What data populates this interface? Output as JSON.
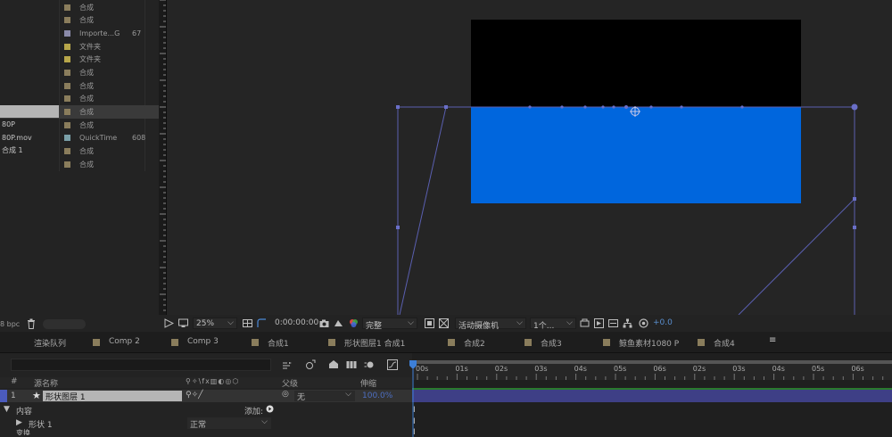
{
  "project": {
    "items": [
      {
        "name": "",
        "type": "合成",
        "size": "",
        "color": "#8a7d5c",
        "selected": false,
        "highlight": false
      },
      {
        "name": "",
        "type": "合成",
        "size": "",
        "color": "#8a7d5c",
        "selected": false,
        "highlight": false
      },
      {
        "name": "",
        "type": "Importe...G",
        "size": "67",
        "color": "#8a8aaa",
        "selected": false,
        "highlight": false
      },
      {
        "name": "",
        "type": "文件夹",
        "size": "",
        "color": "#b7a64a",
        "selected": false,
        "highlight": false
      },
      {
        "name": "",
        "type": "文件夹",
        "size": "",
        "color": "#b7a64a",
        "selected": false,
        "highlight": false
      },
      {
        "name": "",
        "type": "合成",
        "size": "",
        "color": "#8a7d5c",
        "selected": false,
        "highlight": false
      },
      {
        "name": "",
        "type": "合成",
        "size": "",
        "color": "#8a7d5c",
        "selected": false,
        "highlight": false
      },
      {
        "name": "",
        "type": "合成",
        "size": "",
        "color": "#8a7d5c",
        "selected": false,
        "highlight": false
      },
      {
        "name": "",
        "type": "合成",
        "size": "",
        "color": "#8a7d5c",
        "selected": true,
        "highlight": true
      },
      {
        "name": "80P",
        "type": "合成",
        "size": "",
        "color": "#8a7d5c",
        "selected": false,
        "highlight": false
      },
      {
        "name": "80P.mov",
        "type": "QuickTime",
        "size": "608",
        "color": "#7aa0a8",
        "selected": false,
        "highlight": false
      },
      {
        "name": "合成 1",
        "type": "合成",
        "size": "",
        "color": "#8a7d5c",
        "selected": false,
        "highlight": false
      },
      {
        "name": "",
        "type": "合成",
        "size": "",
        "color": "#8a7d5c",
        "selected": false,
        "highlight": false
      }
    ],
    "bpc_label": "8 bpc"
  },
  "viewer": {
    "zoom": "25%",
    "timecode": "0:00:00:00",
    "resolution": "完整",
    "camera": "活动摄像机",
    "views": "1个...",
    "exposure": "+0.0",
    "comp_color": "#000000",
    "shape_color": "#0066dd",
    "path_color": "#5a5fb0"
  },
  "tabs": [
    {
      "label": "渲染队列",
      "swatch": null
    },
    {
      "label": "Comp 2",
      "swatch": "#8a7d5c"
    },
    {
      "label": "Comp 3",
      "swatch": "#8a7d5c"
    },
    {
      "label": "合成1",
      "swatch": "#8a7d5c"
    },
    {
      "label": "形状图层1 合成1",
      "swatch": "#8a7d5c"
    },
    {
      "label": "合成2",
      "swatch": "#8a7d5c"
    },
    {
      "label": "合成3",
      "swatch": "#8a7d5c"
    },
    {
      "label": "鲸鱼素材1080 P",
      "swatch": "#8a7d5c"
    },
    {
      "label": "合成4",
      "swatch": "#8a7d5c"
    }
  ],
  "layers": {
    "search_placeholder": "",
    "col_hash": "#",
    "col_source": "源名称",
    "col_parent": "父级",
    "col_stretch": "伸缩",
    "layer_index": "1",
    "layer_name": "形状图层 1",
    "parent_value": "无",
    "stretch_value": "100.0%",
    "contents_label": "内容",
    "add_label": "添加:",
    "shape_label": "形状 1",
    "mode_value": "正常",
    "transform_label": "变换"
  },
  "timeline": {
    "ticks": [
      "00s",
      "01s",
      "02s",
      "03s",
      "04s",
      "05s",
      "06s",
      "02s",
      "03s",
      "04s",
      "05s",
      "06s"
    ],
    "bar_color": "#3e3f86"
  }
}
